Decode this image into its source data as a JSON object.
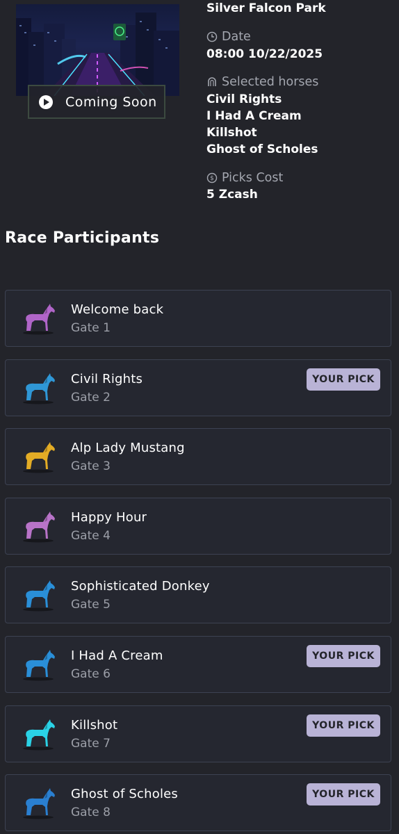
{
  "race": {
    "track_name": "Silver Falcon Park",
    "coming_soon_label": "Coming Soon",
    "date_label": "Date",
    "date_value": "08:00 10/22/2025",
    "selected_horses_label": "Selected horses",
    "selected_horses": [
      "Civil Rights",
      "I Had A Cream",
      "Killshot",
      "Ghost of Scholes"
    ],
    "picks_cost_label": "Picks Cost",
    "picks_cost_value": "5 Zcash"
  },
  "participants": {
    "title": "Race Participants",
    "pick_badge_label": "YOUR PICK",
    "items": [
      {
        "name": "Welcome back",
        "gate": "Gate 1",
        "color": "#b065c8",
        "your_pick": false
      },
      {
        "name": "Civil Rights",
        "gate": "Gate 2",
        "color": "#2f97d6",
        "your_pick": true
      },
      {
        "name": "Alp Lady Mustang",
        "gate": "Gate 3",
        "color": "#e3ac25",
        "your_pick": false
      },
      {
        "name": "Happy Hour",
        "gate": "Gate 4",
        "color": "#b873c8",
        "your_pick": false
      },
      {
        "name": "Sophisticated Donkey",
        "gate": "Gate 5",
        "color": "#2a8fd8",
        "your_pick": false
      },
      {
        "name": "I Had A Cream",
        "gate": "Gate 6",
        "color": "#2a8fd8",
        "your_pick": true
      },
      {
        "name": "Killshot",
        "gate": "Gate 7",
        "color": "#2ad2e6",
        "your_pick": true
      },
      {
        "name": "Ghost of Scholes",
        "gate": "Gate 8",
        "color": "#2a7fd0",
        "your_pick": true
      }
    ]
  },
  "icons": {
    "date": "clock-icon",
    "selected_horses": "horseshoe-icon",
    "picks_cost": "coin-icon",
    "play": "play-icon",
    "horse": "horse-icon"
  }
}
